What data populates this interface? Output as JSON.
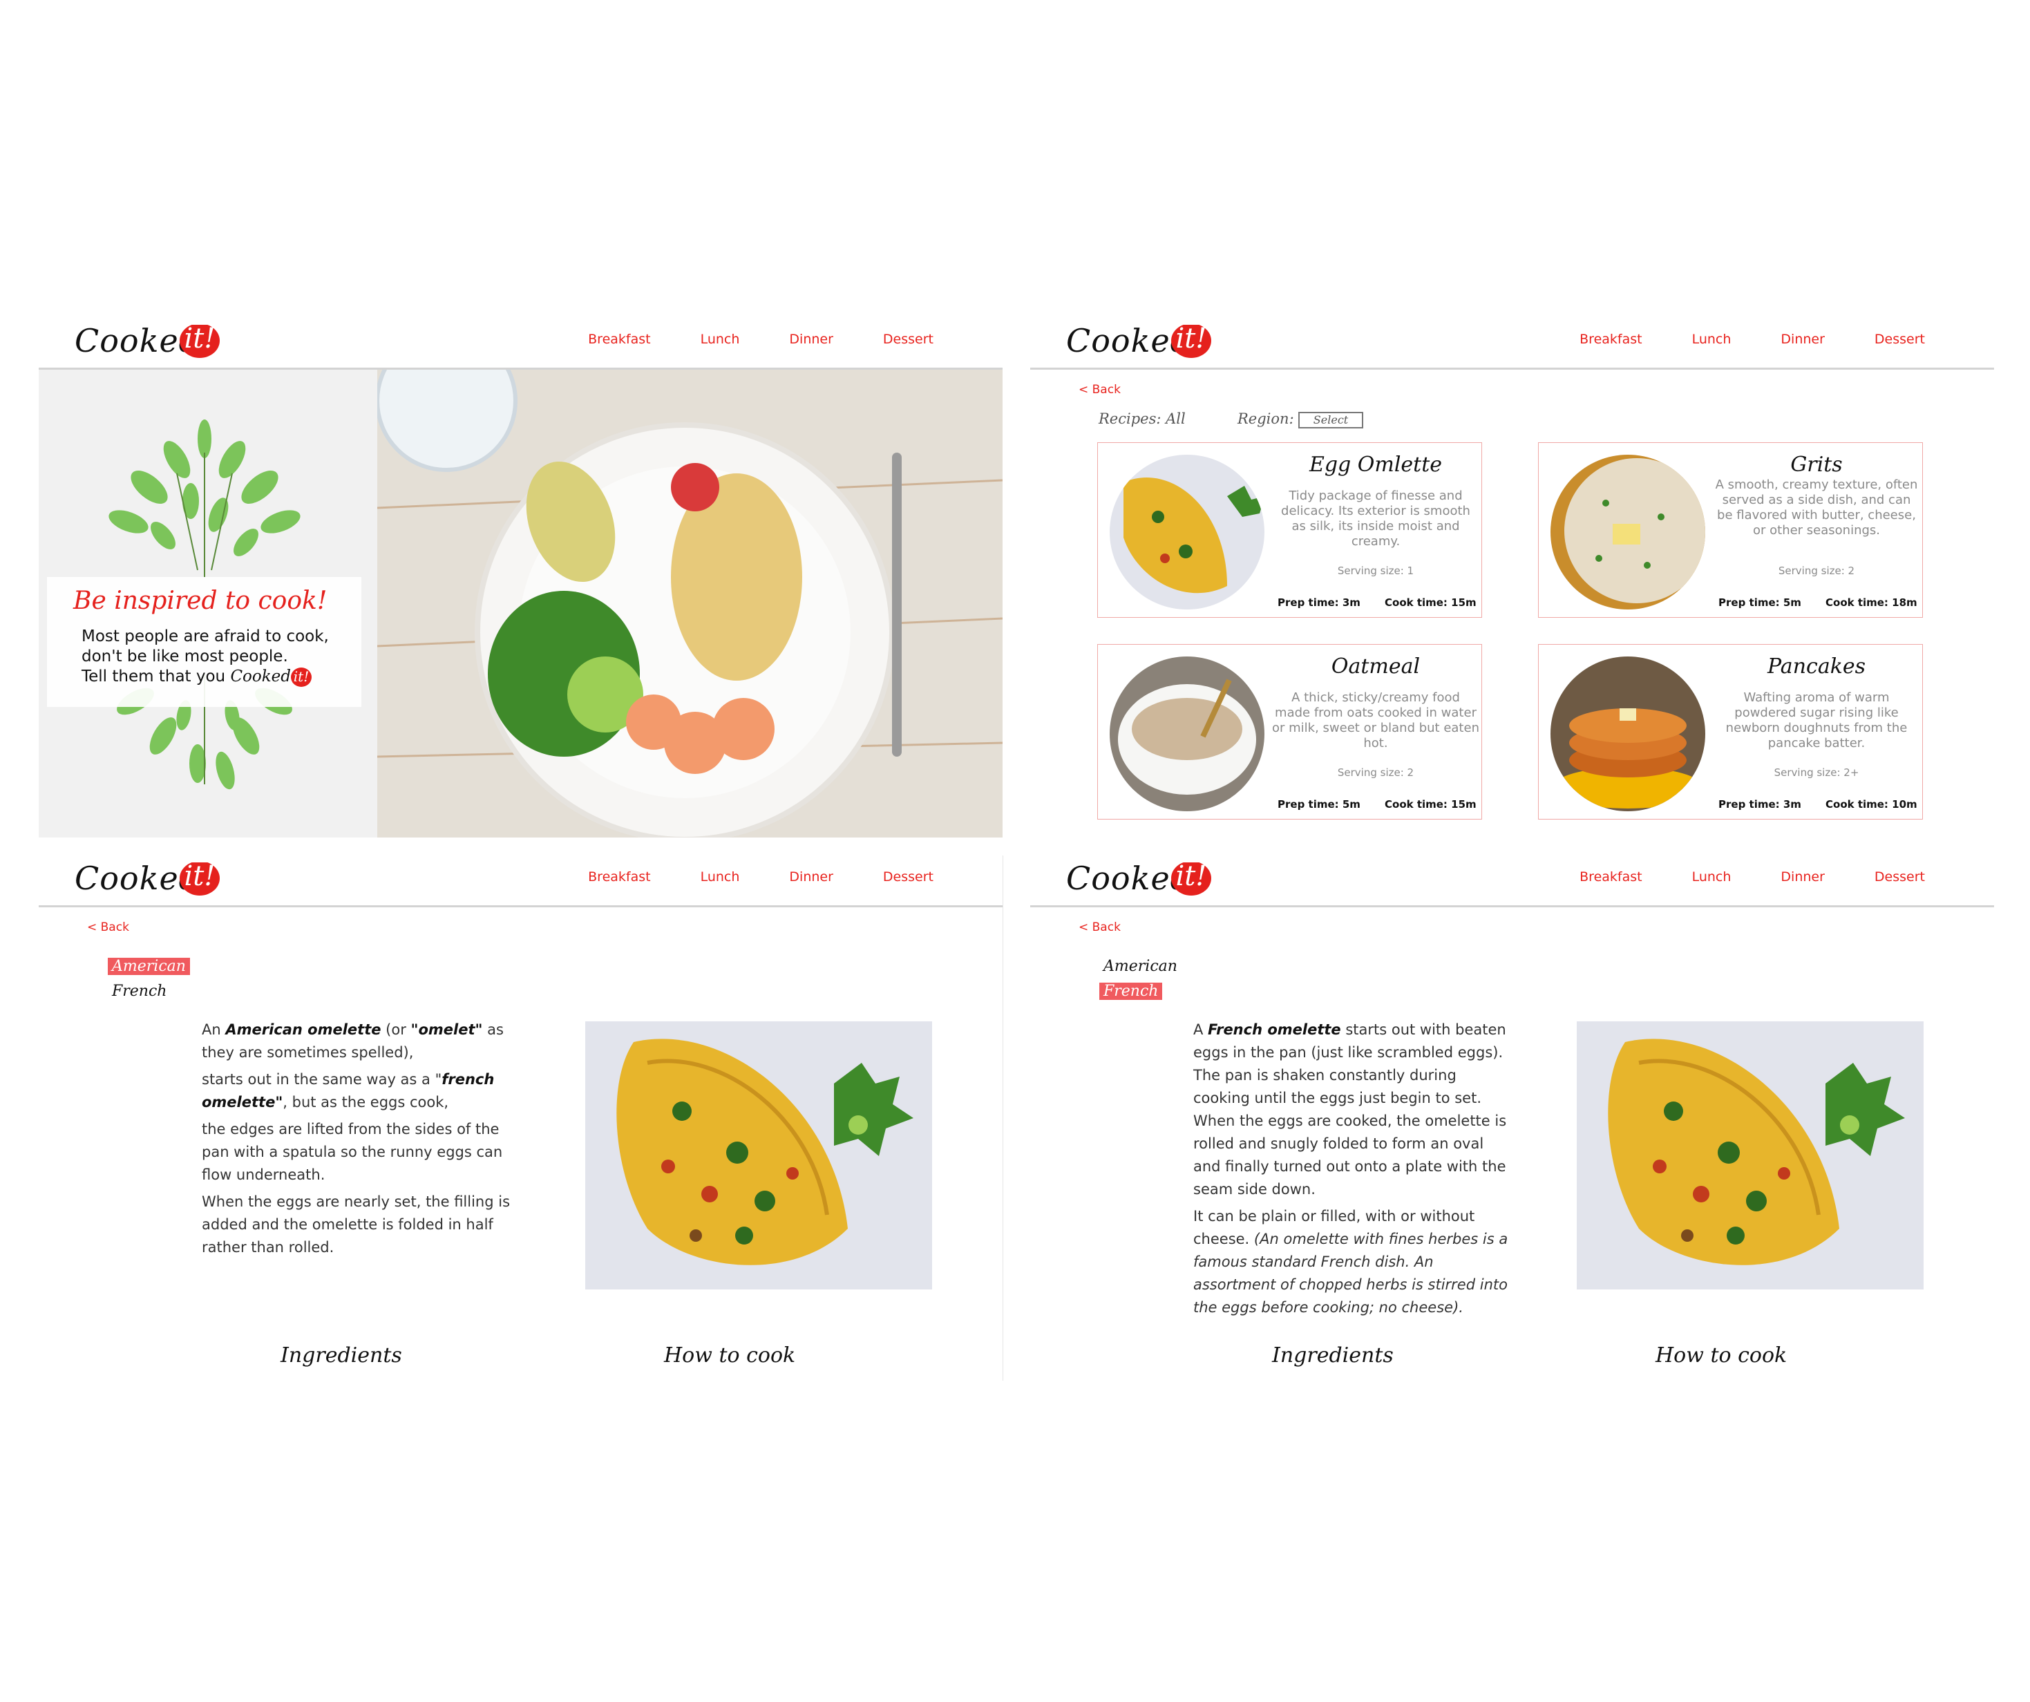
{
  "brand": {
    "logo_text": "Cooked",
    "logo_badge": "it!"
  },
  "nav": {
    "items": [
      "Breakfast",
      "Lunch",
      "Dinner",
      "Dessert"
    ]
  },
  "colors": {
    "accent": "#e5211d",
    "highlight": "#f05a5e",
    "card_border": "#f0a8a6"
  },
  "home": {
    "hero_title": "Be inspired to cook!",
    "hero_line1": "Most people are afraid to cook,",
    "hero_line2": "don't be like most people.",
    "hero_line3": "Tell them that you ",
    "hero_brand": "Cooked",
    "hero_brand_badge": "it!"
  },
  "listing": {
    "back": "< Back",
    "recipes_filter": "Recipes: All",
    "region_label": "Region:",
    "region_select": "Select",
    "cards": [
      {
        "title": "Egg Omlette",
        "desc": "Tidy package of finesse and delicacy. Its exterior is smooth as silk, its inside moist and creamy.",
        "serving": "Serving size: 1",
        "prep": "Prep time: 3m",
        "cook": "Cook time: 15m"
      },
      {
        "title": "Grits",
        "desc": "A smooth, creamy texture, often served as a side dish, and can be flavored with butter, cheese, or other seasonings.",
        "serving": "Serving size: 2",
        "prep": "Prep time: 5m",
        "cook": "Cook time: 18m"
      },
      {
        "title": "Oatmeal",
        "desc": "A thick, sticky/creamy food made from oats cooked in water or milk, sweet or bland but eaten hot.",
        "serving": "Serving size: 2",
        "prep": "Prep time: 5m",
        "cook": "Cook time: 15m"
      },
      {
        "title": "Pancakes",
        "desc": "Wafting aroma of warm powdered sugar rising like newborn doughnuts from the pancake batter.",
        "serving": "Serving size: 2+",
        "prep": "Prep time: 3m",
        "cook": "Cook time: 10m"
      }
    ]
  },
  "detail": {
    "back": "< Back",
    "region_american": "American",
    "region_french": "French",
    "ingredients": "Ingredients",
    "how_to_cook": "How to cook",
    "american": {
      "p1_a": "An ",
      "p1_b": "American omelette",
      "p1_c": " (or ",
      "p1_d": "\"omelet\"",
      "p1_e": " as they are sometimes spelled),",
      "p2_a": "starts out in the same way as a \"",
      "p2_b": "french omelette\"",
      "p2_c": ", but as the eggs cook,",
      "p3": "the edges are lifted from the sides of the pan with a spatula so the runny eggs can flow underneath.",
      "p4": "When the eggs are nearly set, the filling is added and the omelette is folded in half rather than rolled."
    },
    "french": {
      "p1_a": "A ",
      "p1_b": "French omelette",
      "p1_c": " starts out with beaten eggs in the pan (just like scrambled eggs). The pan is shaken constantly during cooking until the eggs just begin to set. When the eggs are cooked, the omelette is rolled and snugly folded to form an oval and finally turned out onto a plate with the seam side down.",
      "p2_a": "It can be plain or filled, with or without cheese. ",
      "p2_b": "(An omelette with fines herbes is a famous standard French dish. An assortment of chopped herbs is stirred into the eggs before cooking; no cheese)."
    }
  }
}
